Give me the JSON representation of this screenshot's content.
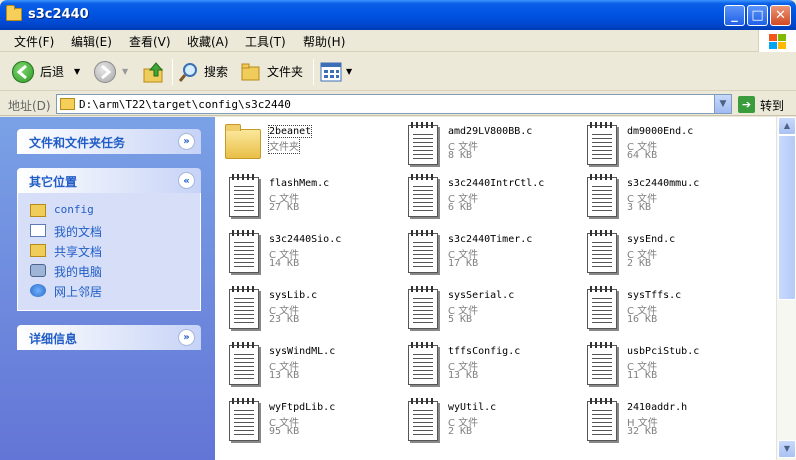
{
  "window": {
    "title": "s3c2440",
    "min_label": "_",
    "max_label": "□",
    "close_label": "✕"
  },
  "menu": [
    "文件(F)",
    "编辑(E)",
    "查看(V)",
    "收藏(A)",
    "工具(T)",
    "帮助(H)"
  ],
  "toolbar": {
    "back": "后退",
    "search": "搜索",
    "folders": "文件夹"
  },
  "address": {
    "label": "地址(D)",
    "value": "D:\\arm\\T22\\target\\config\\s3c2440",
    "go": "转到"
  },
  "tasks": {
    "file_tasks": "文件和文件夹任务",
    "other_places": "其它位置",
    "details": "详细信息",
    "places": [
      "config",
      "我的文档",
      "共享文档",
      "我的电脑",
      "网上邻居"
    ]
  },
  "files": [
    {
      "name": "2beanet",
      "type": "文件夹",
      "size": ""
    },
    {
      "name": "amd29LV800BB.c",
      "type": "C 文件",
      "size": "8 KB"
    },
    {
      "name": "dm9000End.c",
      "type": "C 文件",
      "size": "64 KB"
    },
    {
      "name": "flashMem.c",
      "type": "C 文件",
      "size": "27 KB"
    },
    {
      "name": "s3c2440IntrCtl.c",
      "type": "C 文件",
      "size": "6 KB"
    },
    {
      "name": "s3c2440mmu.c",
      "type": "C 文件",
      "size": "3 KB"
    },
    {
      "name": "s3c2440Sio.c",
      "type": "C 文件",
      "size": "14 KB"
    },
    {
      "name": "s3c2440Timer.c",
      "type": "C 文件",
      "size": "17 KB"
    },
    {
      "name": "sysEnd.c",
      "type": "C 文件",
      "size": "2 KB"
    },
    {
      "name": "sysLib.c",
      "type": "C 文件",
      "size": "23 KB"
    },
    {
      "name": "sysSerial.c",
      "type": "C 文件",
      "size": "5 KB"
    },
    {
      "name": "sysTffs.c",
      "type": "C 文件",
      "size": "16 KB"
    },
    {
      "name": "sysWindML.c",
      "type": "C 文件",
      "size": "13 KB"
    },
    {
      "name": "tffsConfig.c",
      "type": "C 文件",
      "size": "13 KB"
    },
    {
      "name": "usbPciStub.c",
      "type": "C 文件",
      "size": "11 KB"
    },
    {
      "name": "wyFtpdLib.c",
      "type": "C 文件",
      "size": "95 KB"
    },
    {
      "name": "wyUtil.c",
      "type": "C 文件",
      "size": "2 KB"
    },
    {
      "name": "2410addr.h",
      "type": "H 文件",
      "size": "32 KB"
    }
  ]
}
